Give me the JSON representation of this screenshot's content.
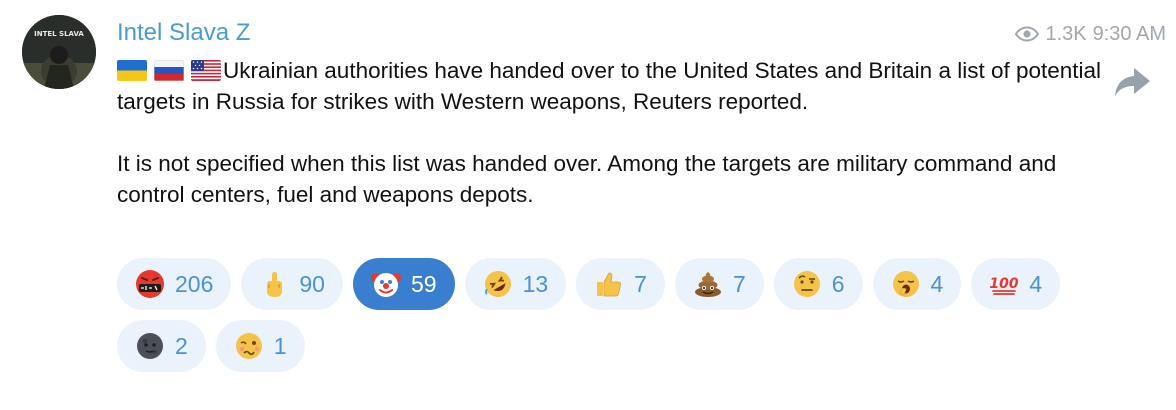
{
  "channel": {
    "name": "Intel Slava Z",
    "avatar_text": "INTEL SLAVA"
  },
  "meta": {
    "views": "1.3K",
    "time": "9:30 AM",
    "views_icon": "eye-icon"
  },
  "message": {
    "flags": [
      "flag-ukraine",
      "flag-russia",
      "flag-usa"
    ],
    "paragraph1": "Ukrainian authorities have handed over to the United States and Britain a list of potential targets in Russia for strikes with Western weapons, Reuters reported.",
    "paragraph2": "It is not specified when this list was handed over. Among the targets are military command and control centers, fuel and weapons depots."
  },
  "reactions": [
    {
      "emoji": "swearing-face-emoji",
      "count": "206",
      "active": false
    },
    {
      "emoji": "middle-finger-emoji",
      "count": "90",
      "active": false
    },
    {
      "emoji": "clown-face-emoji",
      "count": "59",
      "active": true
    },
    {
      "emoji": "rolling-laughing-emoji",
      "count": "13",
      "active": false
    },
    {
      "emoji": "thumbs-up-emoji",
      "count": "7",
      "active": false
    },
    {
      "emoji": "pile-of-poo-emoji",
      "count": "7",
      "active": false
    },
    {
      "emoji": "raised-eyebrow-emoji",
      "count": "6",
      "active": false
    },
    {
      "emoji": "yawning-face-emoji",
      "count": "4",
      "active": false
    },
    {
      "emoji": "hundred-points-emoji",
      "count": "4",
      "active": false
    },
    {
      "emoji": "new-moon-face-emoji",
      "count": "2",
      "active": false
    },
    {
      "emoji": "woozy-face-emoji",
      "count": "1",
      "active": false
    }
  ],
  "colors": {
    "accent": "#4a9bd1",
    "reaction_bg": "#eaf2fb",
    "reaction_active_bg": "#3a7fcf",
    "meta": "#a0a7ae"
  }
}
